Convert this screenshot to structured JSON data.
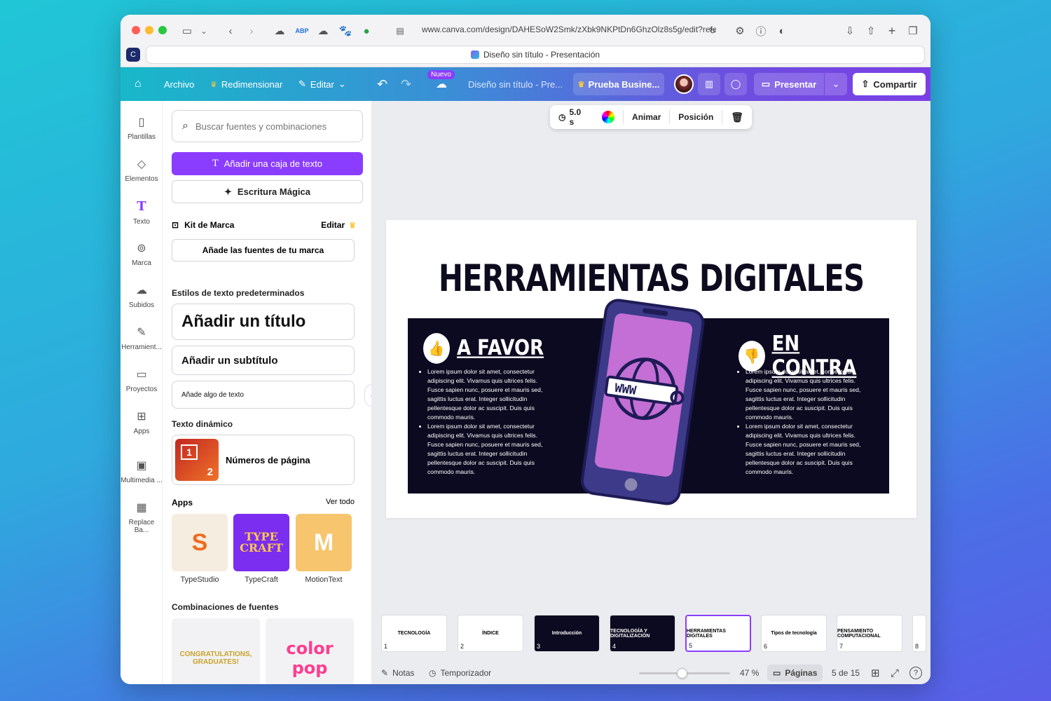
{
  "browser": {
    "url": "www.canva.com/design/DAHESoW2Smk/zXbk9NKPtDn6GhzOlz8s5g/edit?refe",
    "tab_title": "Diseño sin título - Presentación"
  },
  "appbar": {
    "archivo": "Archivo",
    "redimensionar": "Redimensionar",
    "editar": "Editar",
    "nuevo_badge": "Nuevo",
    "doc_title": "Diseño sin título - Pre...",
    "trial": "Prueba Busine...",
    "presentar": "Presentar",
    "compartir": "Compartir"
  },
  "rail": {
    "items": [
      "Plantillas",
      "Elementos",
      "Texto",
      "Marca",
      "Subidos",
      "Herramient...",
      "Proyectos",
      "Apps",
      "Multimedia ...",
      "Replace Ba..."
    ]
  },
  "panel": {
    "search_placeholder": "Buscar fuentes y combinaciones",
    "add_text_box": "Añadir una caja de texto",
    "magic_write": "Escritura Mágica",
    "brand_kit": "Kit de Marca",
    "brand_edit": "Editar",
    "brand_add_fonts": "Añade las fuentes de tu marca",
    "default_styles": "Estilos de texto predeterminados",
    "add_title": "Añadir un título",
    "add_subtitle": "Añadir un subtítulo",
    "add_body": "Añade algo de texto",
    "dynamic_text": "Texto dinámico",
    "page_numbers": "Números de página",
    "page_thumb_a": "1",
    "page_thumb_b": "2",
    "apps": "Apps",
    "see_all": "Ver todo",
    "app_names": [
      "TypeStudio",
      "TypeCraft",
      "MotionText"
    ],
    "font_combos": "Combinaciones de fuentes",
    "combo_1": "CONGRATULATIONS, GRADUATES!",
    "combo_2": "color pop"
  },
  "toolbar": {
    "duration": "5.0 s",
    "animate": "Animar",
    "position": "Posición"
  },
  "slide": {
    "title": "HERRAMIENTAS DIGITALES",
    "left_title": "A FAVOR",
    "right_title": "EN CONTRA",
    "phone_text": "WWW",
    "left_bullets": [
      "Lorem ipsum dolor sit amet, consectetur adipiscing elit. Vivamus quis ultrices felis. Fusce sapien nunc, posuere et mauris sed, sagittis luctus erat. Integer sollicitudin pellentesque dolor ac suscipit. Duis quis commodo mauris.",
      "Lorem ipsum dolor sit amet, consectetur adipiscing elit. Vivamus quis ultrices felis. Fusce sapien nunc, posuere et mauris sed, sagittis luctus erat. Integer sollicitudin pellentesque dolor ac suscipit. Duis quis commodo mauris."
    ],
    "right_bullets": [
      "Lorem ipsum dolor sit amet, consectetur adipiscing elit. Vivamus quis ultrices felis. Fusce sapien nunc, posuere et mauris sed, sagittis luctus erat. Integer sollicitudin pellentesque dolor ac suscipit. Duis quis commodo mauris.",
      "Lorem ipsum dolor sit amet, consectetur adipiscing elit. Vivamus quis ultrices felis. Fusce sapien nunc, posuere et mauris sed, sagittis luctus erat. Integer sollicitudin pellentesque dolor ac suscipit. Duis quis commodo mauris."
    ]
  },
  "pages": [
    {
      "num": "1",
      "label": "TECNOLOGÍA"
    },
    {
      "num": "2",
      "label": "ÍNDICE"
    },
    {
      "num": "3",
      "label": "Introducción"
    },
    {
      "num": "4",
      "label": "TECNOLOGÍA Y DIGITALIZACIÓN"
    },
    {
      "num": "5",
      "label": "HERRAMIENTAS DIGITALES"
    },
    {
      "num": "6",
      "label": "Tipos de tecnología"
    },
    {
      "num": "7",
      "label": "PENSAMIENTO COMPUTACIONAL"
    },
    {
      "num": "8",
      "label": ""
    }
  ],
  "footer": {
    "notes": "Notas",
    "timer": "Temporizador",
    "zoom": "47 %",
    "zoom_fraction": 0.47,
    "pages": "Páginas",
    "page_counter": "5 de 15"
  },
  "colors": {
    "accent": "#8b3dff",
    "slide_dark": "#0c0a20",
    "phone_screen": "#c36fd6"
  }
}
